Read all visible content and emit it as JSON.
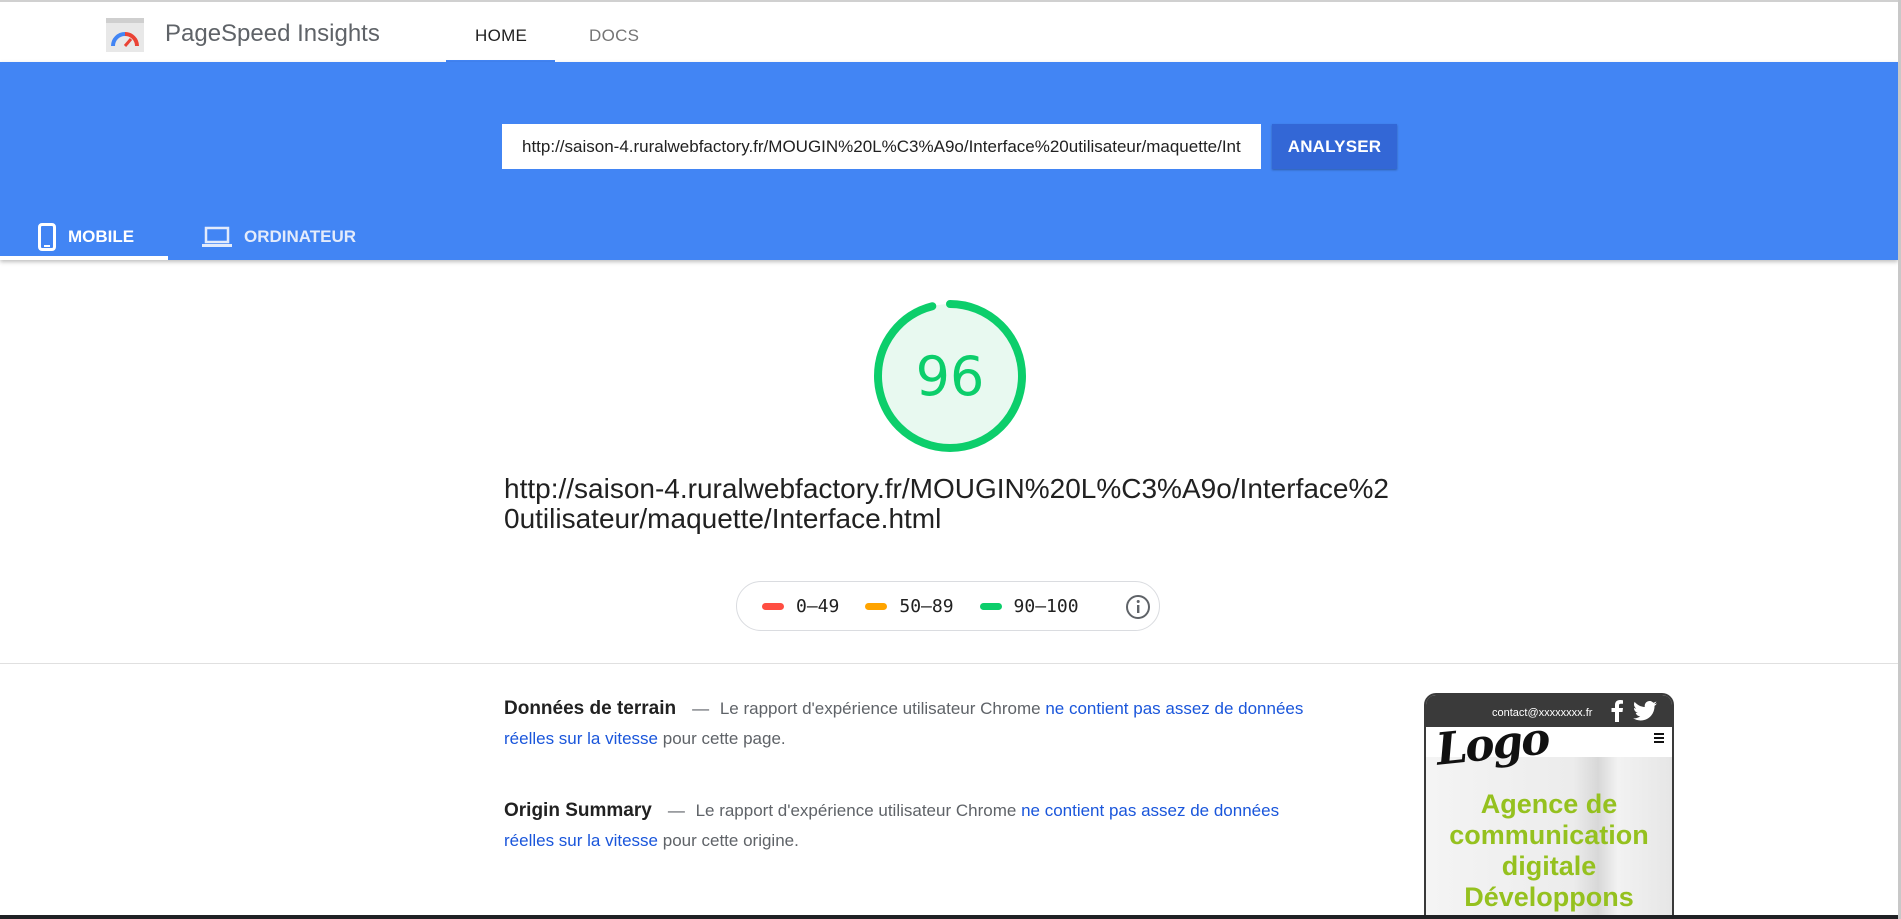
{
  "app": {
    "title": "PageSpeed Insights",
    "nav": [
      {
        "label": "HOME",
        "active": true
      },
      {
        "label": "DOCS",
        "active": false
      }
    ]
  },
  "search": {
    "url_value": "http://saison-4.ruralwebfactory.fr/MOUGIN%20L%C3%A9o/Interface%20utilisateur/maquette/Interface.html",
    "button_label": "ANALYSER"
  },
  "device_tabs": [
    {
      "label": "MOBILE",
      "icon": "smartphone-icon",
      "active": true
    },
    {
      "label": "ORDINATEUR",
      "icon": "laptop-icon",
      "active": false
    }
  ],
  "result": {
    "score": "96",
    "score_fraction": 0.96,
    "tested_url": "http://saison-4.ruralwebfactory.fr/MOUGIN%20L%C3%A9o/Interface%20utilisateur/maquette/Interface.html"
  },
  "legend": [
    {
      "label": "0–49",
      "color": "#ff4e42"
    },
    {
      "label": "50–89",
      "color": "#ffa400"
    },
    {
      "label": "90–100",
      "color": "#0cce6b"
    }
  ],
  "field_data": {
    "title": "Données de terrain",
    "separator": "—",
    "text_before": "Le rapport d'expérience utilisateur Chrome",
    "link": "ne contient pas assez de données réelles sur la vitesse",
    "text_after": "pour cette page."
  },
  "origin_summary": {
    "title": "Origin Summary",
    "separator": "—",
    "text_before": "Le rapport d'expérience utilisateur Chrome",
    "link": "ne contient pas assez de données réelles sur la vitesse",
    "text_after": "pour cette origine."
  },
  "thumbnail": {
    "contact": "contact@xxxxxxxx.fr",
    "logo_text": "Logo",
    "headline": "Agence de communication digitale Développons"
  },
  "colors": {
    "brand_blue": "#4285f4",
    "button_blue": "#3367d6",
    "pass_green": "#0cce6b",
    "link_blue": "#1a56db"
  }
}
